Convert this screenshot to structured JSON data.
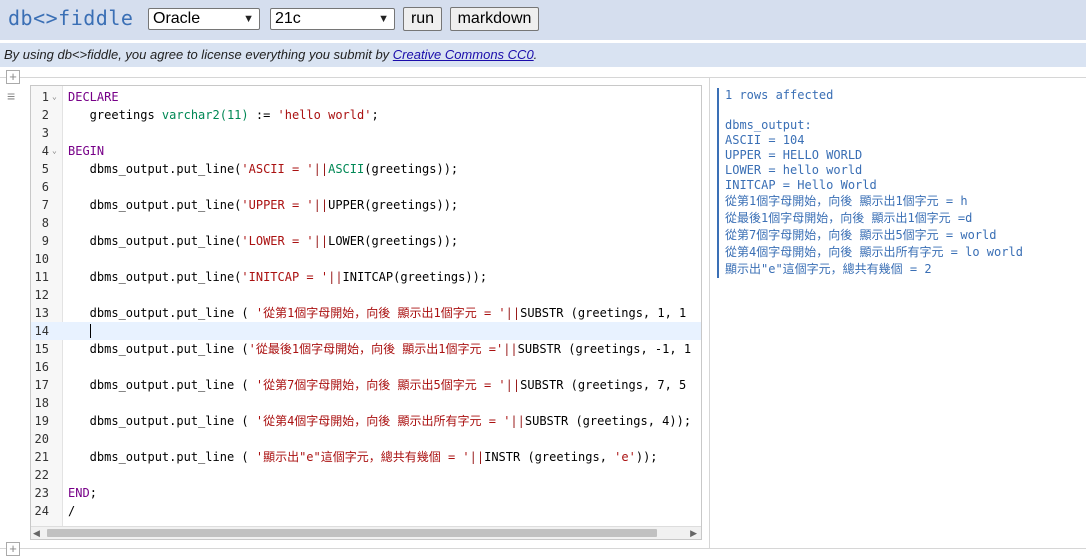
{
  "header": {
    "logo": "db<>fiddle",
    "database_select": "Oracle",
    "version_select": "21c",
    "run_label": "run",
    "markdown_label": "markdown"
  },
  "license": {
    "text": "By using db<>fiddle, you agree to license everything you submit by ",
    "link": "Creative Commons CC0",
    "suffix": "."
  },
  "editor": {
    "active_line": 14,
    "lines": [
      {
        "n": "1",
        "fold": true
      },
      {
        "n": "2"
      },
      {
        "n": "3"
      },
      {
        "n": "4",
        "fold": true
      },
      {
        "n": "5"
      },
      {
        "n": "6"
      },
      {
        "n": "7"
      },
      {
        "n": "8"
      },
      {
        "n": "9"
      },
      {
        "n": "10"
      },
      {
        "n": "11"
      },
      {
        "n": "12"
      },
      {
        "n": "13"
      },
      {
        "n": "14"
      },
      {
        "n": "15"
      },
      {
        "n": "16"
      },
      {
        "n": "17"
      },
      {
        "n": "18"
      },
      {
        "n": "19"
      },
      {
        "n": "20"
      },
      {
        "n": "21"
      },
      {
        "n": "22"
      },
      {
        "n": "23"
      },
      {
        "n": "24"
      }
    ],
    "code": {
      "l1_kw": "DECLARE",
      "l2_name": "   greetings ",
      "l2_type": "varchar2(11)",
      "l2_op": " := ",
      "l2_str": "'hello world'",
      "l2_end": ";",
      "l4_kw": "BEGIN",
      "l5_a": "   dbms_output.put_line(",
      "l5_str": "'ASCII = '",
      "l5_op": "||",
      "l5_fn": "ASCII",
      "l5_b": "(greetings));",
      "l7_a": "   dbms_output.put_line(",
      "l7_str": "'UPPER = '",
      "l7_op": "||",
      "l7_b": "UPPER(greetings));",
      "l9_a": "   dbms_output.put_line(",
      "l9_str": "'LOWER = '",
      "l9_op": "||",
      "l9_b": "LOWER(greetings));",
      "l11_a": "   dbms_output.put_line(",
      "l11_str": "'INITCAP = '",
      "l11_op": "||",
      "l11_b": "INITCAP(greetings));",
      "l13_a": "   dbms_output.put_line ( ",
      "l13_str": "'從第1個字母開始，向後 顯示出1個字元 = '",
      "l13_op": "||",
      "l13_b": "SUBSTR (greetings, 1, 1",
      "l15_a": "   dbms_output.put_line (",
      "l15_str": "'從最後1個字母開始，向後 顯示出1個字元 ='",
      "l15_op": "||",
      "l15_b": "SUBSTR (greetings, -1, 1",
      "l17_a": "   dbms_output.put_line ( ",
      "l17_str": "'從第7個字母開始，向後 顯示出5個字元 = '",
      "l17_op": "||",
      "l17_b": "SUBSTR (greetings, 7, 5",
      "l19_a": "   dbms_output.put_line ( ",
      "l19_str": "'從第4個字母開始，向後 顯示出所有字元 = '",
      "l19_op": "||",
      "l19_b": "SUBSTR (greetings, 4));",
      "l21_a": "   dbms_output.put_line ( ",
      "l21_str": "'顯示出\"e\"這個字元，總共有幾個 = '",
      "l21_op": "||",
      "l21_b": "INSTR (greetings, ",
      "l21_str2": "'e'",
      "l21_end": "));",
      "l23_kw": "END",
      "l23_end": ";",
      "l24": "/"
    }
  },
  "output": {
    "rows_affected": "1 rows affected",
    "title": "dbms_output:",
    "lines": [
      "ASCII = 104",
      "UPPER = HELLO WORLD",
      "LOWER = hello world",
      "INITCAP = Hello World",
      "從第1個字母開始，向後 顯示出1個字元 = h",
      "從最後1個字母開始，向後 顯示出1個字元 =d",
      "從第7個字母開始，向後 顯示出5個字元 = world",
      "從第4個字母開始，向後 顯示出所有字元 = lo world",
      "顯示出\"e\"這個字元，總共有幾個 = 2"
    ]
  },
  "colors": {
    "header_bg": "#d5deee",
    "license_bg": "#d9e3f2",
    "accent": "#3a6fb5",
    "keyword": "#770088",
    "string": "#aa1111",
    "type": "#008855"
  }
}
